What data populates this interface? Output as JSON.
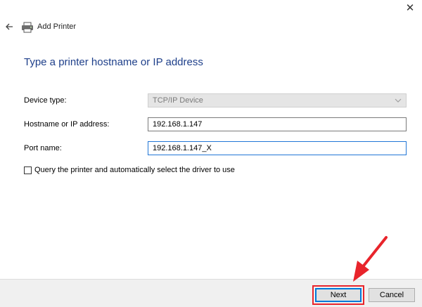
{
  "window": {
    "title": "Add Printer",
    "close_glyph": "✕"
  },
  "heading": "Type a printer hostname or IP address",
  "form": {
    "device_type": {
      "label": "Device type:",
      "value": "TCP/IP Device"
    },
    "hostname": {
      "label": "Hostname or IP address:",
      "value": "192.168.1.147"
    },
    "port_name": {
      "label": "Port name:",
      "value": "192.168.1.147_X"
    },
    "query_checkbox": {
      "label": "Query the printer and automatically select the driver to use",
      "checked": false
    }
  },
  "footer": {
    "next_label": "Next",
    "cancel_label": "Cancel"
  },
  "colors": {
    "heading": "#1e3f8a",
    "highlight": "#e8242b",
    "focus": "#0078d7"
  },
  "icons": {
    "back": "back-arrow-icon",
    "printer": "printer-icon",
    "dropdown": "chevron-down-icon",
    "annotation": "red-arrow-annotation"
  }
}
